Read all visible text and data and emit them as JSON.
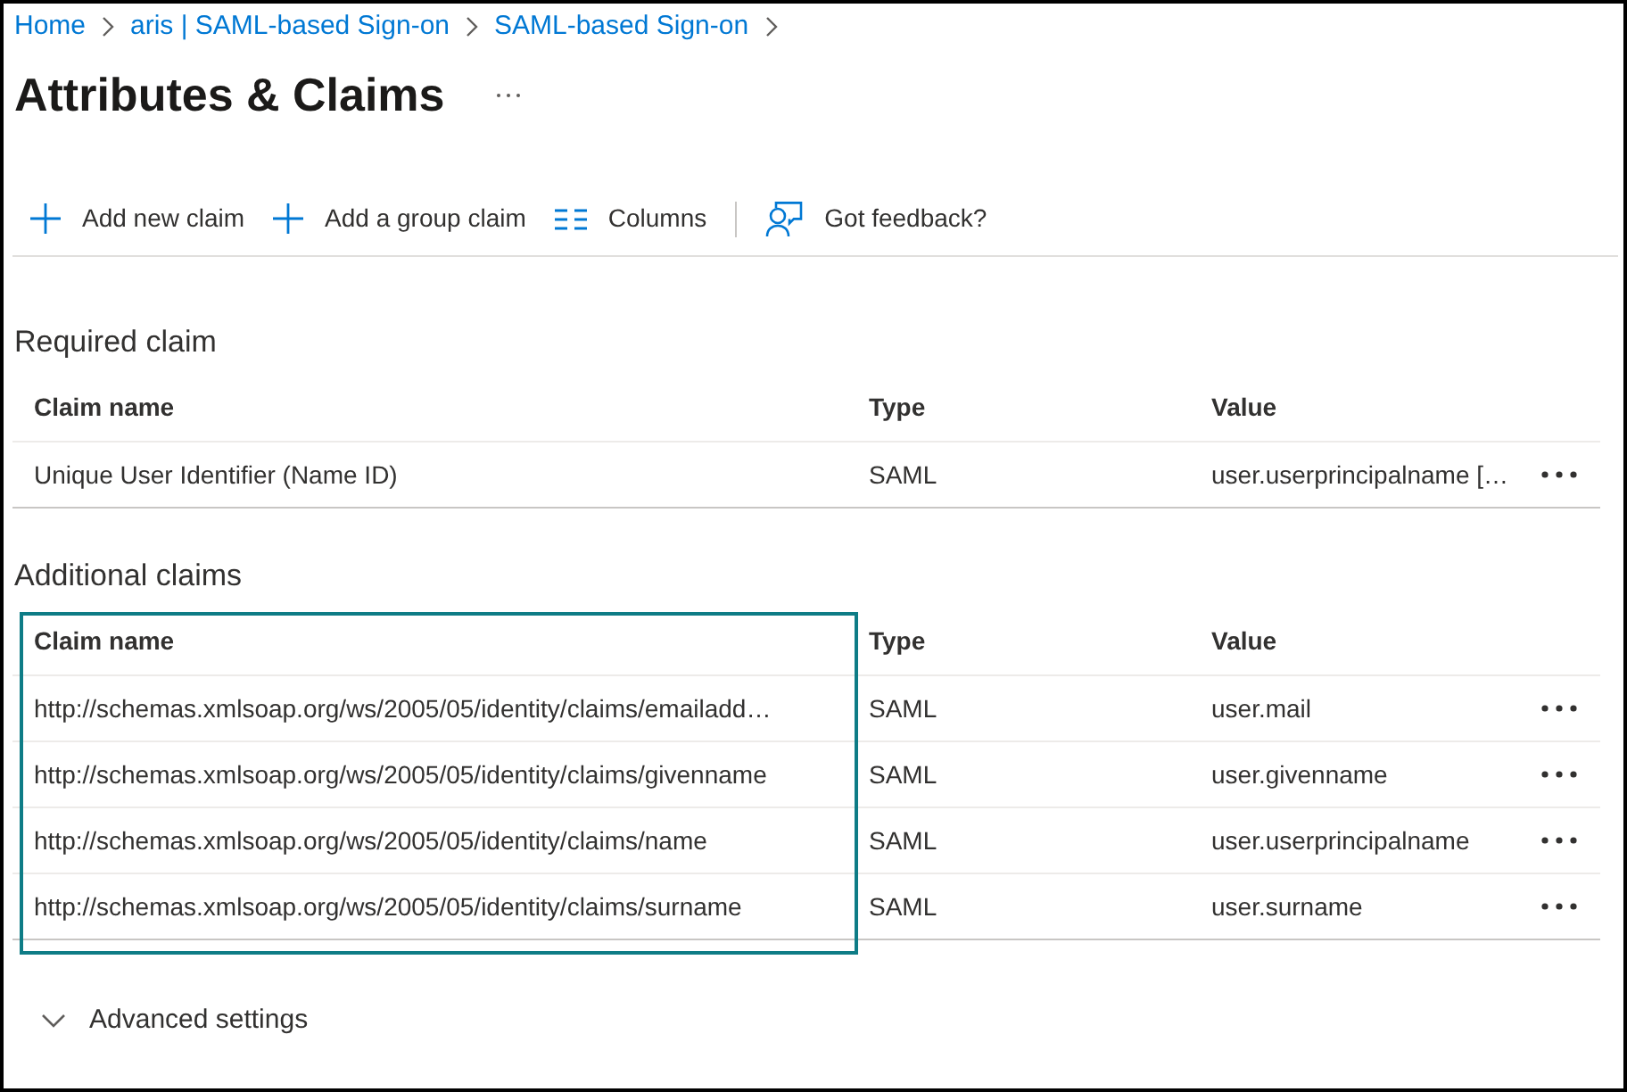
{
  "breadcrumb": [
    {
      "label": "Home"
    },
    {
      "label": "aris | SAML-based Sign-on"
    },
    {
      "label": "SAML-based Sign-on"
    }
  ],
  "page": {
    "title": "Attributes & Claims"
  },
  "toolbar": [
    {
      "kind": "add",
      "label": "Add new claim"
    },
    {
      "kind": "add",
      "label": "Add a group claim"
    },
    {
      "kind": "columns",
      "label": "Columns"
    },
    {
      "kind": "feedback",
      "label": "Got feedback?"
    }
  ],
  "required_claim": {
    "title": "Required claim",
    "columns": [
      "Claim name",
      "Type",
      "Value"
    ],
    "rows": [
      {
        "claim_name": "Unique User Identifier (Name ID)",
        "type": "SAML",
        "value": "user.userprincipalname […"
      }
    ]
  },
  "additional_claims": {
    "title": "Additional claims",
    "highlight_claim_name_column": true,
    "columns": [
      "Claim name",
      "Type",
      "Value"
    ],
    "rows": [
      {
        "claim_name": "http://schemas.xmlsoap.org/ws/2005/05/identity/claims/emailadd…",
        "type": "SAML",
        "value": "user.mail"
      },
      {
        "claim_name": "http://schemas.xmlsoap.org/ws/2005/05/identity/claims/givenname",
        "type": "SAML",
        "value": "user.givenname"
      },
      {
        "claim_name": "http://schemas.xmlsoap.org/ws/2005/05/identity/claims/name",
        "type": "SAML",
        "value": "user.userprincipalname"
      },
      {
        "claim_name": "http://schemas.xmlsoap.org/ws/2005/05/identity/claims/surname",
        "type": "SAML",
        "value": "user.surname"
      }
    ]
  },
  "advanced_settings": {
    "label": "Advanced settings",
    "expanded": false
  }
}
